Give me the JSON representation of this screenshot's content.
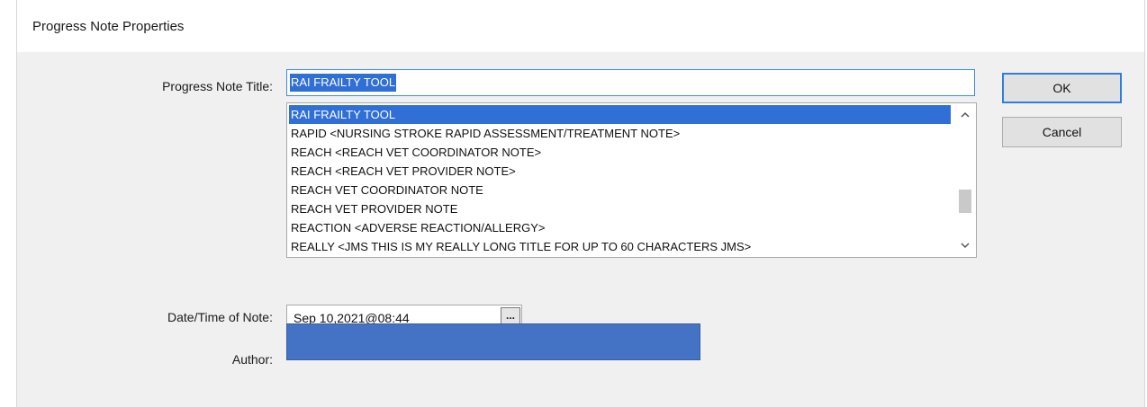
{
  "dialog": {
    "title": "Progress Note Properties"
  },
  "fields": {
    "title_label": "Progress Note Title:",
    "title_value": "RAI FRAILTY TOOL",
    "date_label": "Date/Time of Note:",
    "date_value": "Sep 10,2021@08:44",
    "date_button_label": "...",
    "author_label": "Author:"
  },
  "list": {
    "items": [
      "RAI FRAILTY TOOL",
      "RAPID  <NURSING STROKE RAPID ASSESSMENT/TREATMENT NOTE>",
      "REACH  <REACH VET COORDINATOR NOTE>",
      "REACH  <REACH VET PROVIDER NOTE>",
      "REACH VET COORDINATOR NOTE",
      "REACH VET PROVIDER NOTE",
      "REACTION  <ADVERSE REACTION/ALLERGY>",
      "REALLY  <JMS THIS IS MY REALLY LONG TITLE FOR UP TO 60 CHARACTERS JMS>"
    ],
    "selected_index": 0,
    "scroll_up_icon": "chevron-up-icon",
    "scroll_down_icon": "chevron-down-icon"
  },
  "buttons": {
    "ok": "OK",
    "cancel": "Cancel"
  },
  "colors": {
    "selection": "#2f6fd6",
    "author_fill": "#4472c4",
    "focus_border": "#2f7fd8"
  }
}
